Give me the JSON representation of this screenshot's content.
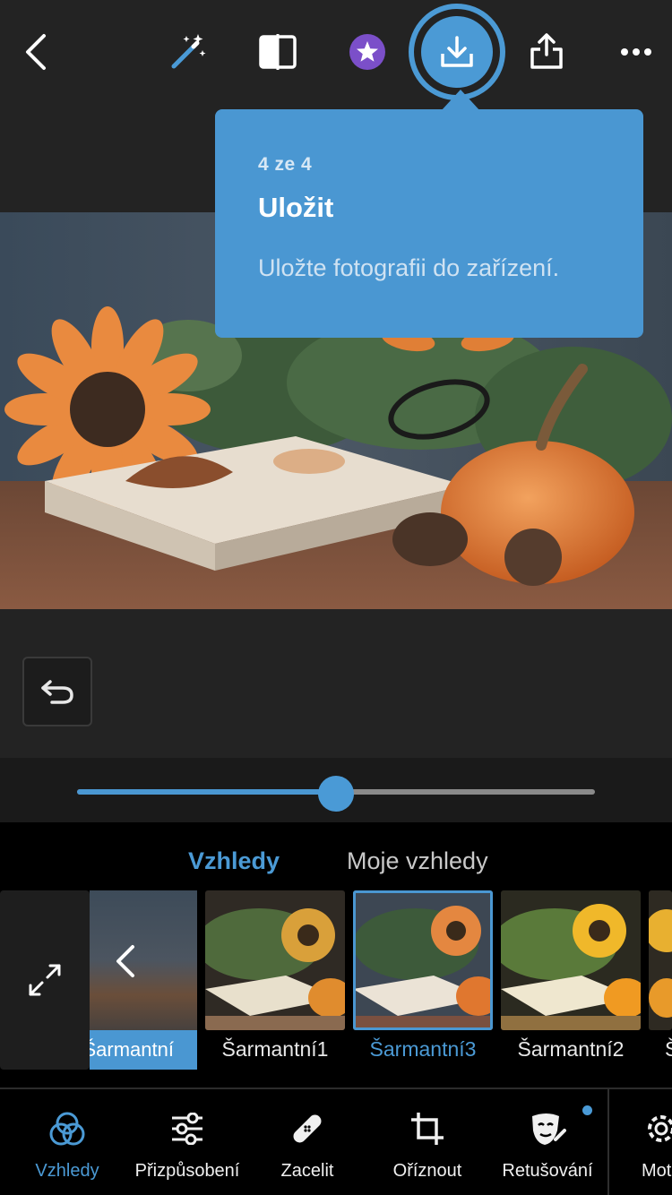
{
  "toolbar": {
    "back_icon": "chevron-left-icon",
    "auto_icon": "magic-wand-icon",
    "compare_icon": "before-after-icon",
    "premium_icon": "star-badge-icon",
    "save_icon": "download-icon",
    "share_icon": "share-icon",
    "more_icon": "more-icon"
  },
  "tooltip": {
    "step": "4 ze 4",
    "title": "Uložit",
    "description": "Uložte fotografii do zařízení."
  },
  "slider": {
    "value": 0.5
  },
  "looks": {
    "tabs": [
      {
        "label": "Vzhledy",
        "active": true
      },
      {
        "label": "Moje vzhledy",
        "active": false
      }
    ],
    "back_card_label": "Šarmantní",
    "presets": [
      {
        "label": "Šarmantní1",
        "selected": false
      },
      {
        "label": "Šarmantní3",
        "selected": true
      },
      {
        "label": "Šarmantní2",
        "selected": false
      },
      {
        "label": "Š",
        "selected": false
      }
    ]
  },
  "nav": {
    "items": [
      {
        "label": "Vzhledy",
        "icon": "looks-icon",
        "active": true
      },
      {
        "label": "Přizpůsobení",
        "icon": "sliders-icon",
        "active": false
      },
      {
        "label": "Zacelit",
        "icon": "bandage-icon",
        "active": false
      },
      {
        "label": "Oříznout",
        "icon": "crop-icon",
        "active": false
      },
      {
        "label": "Retušování",
        "icon": "retouch-icon",
        "active": false
      },
      {
        "label": "Mot",
        "icon": "gear-icon",
        "active": false
      }
    ]
  },
  "colors": {
    "accent": "#4a97d2",
    "background": "#232323",
    "tooltip": "#4a97d2"
  }
}
